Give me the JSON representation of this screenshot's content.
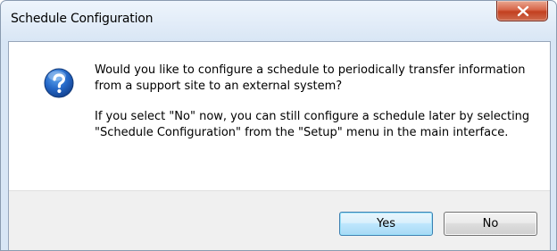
{
  "window": {
    "title": "Schedule Configuration"
  },
  "icons": {
    "message_icon": "question-icon",
    "close_icon": "close-icon"
  },
  "message": {
    "line1": "Would you like to configure a schedule to periodically transfer information from a support site to an external system?",
    "line2": "If you select \"No\" now, you can still configure a schedule later by selecting \"Schedule Configuration\" from the \"Setup\" menu in the main interface."
  },
  "buttons": {
    "yes_label": "Yes",
    "no_label": "No"
  },
  "colors": {
    "close_button": "#c94a2b",
    "default_button_border": "#3c7fb1",
    "question_icon": "#1f5fb8"
  }
}
